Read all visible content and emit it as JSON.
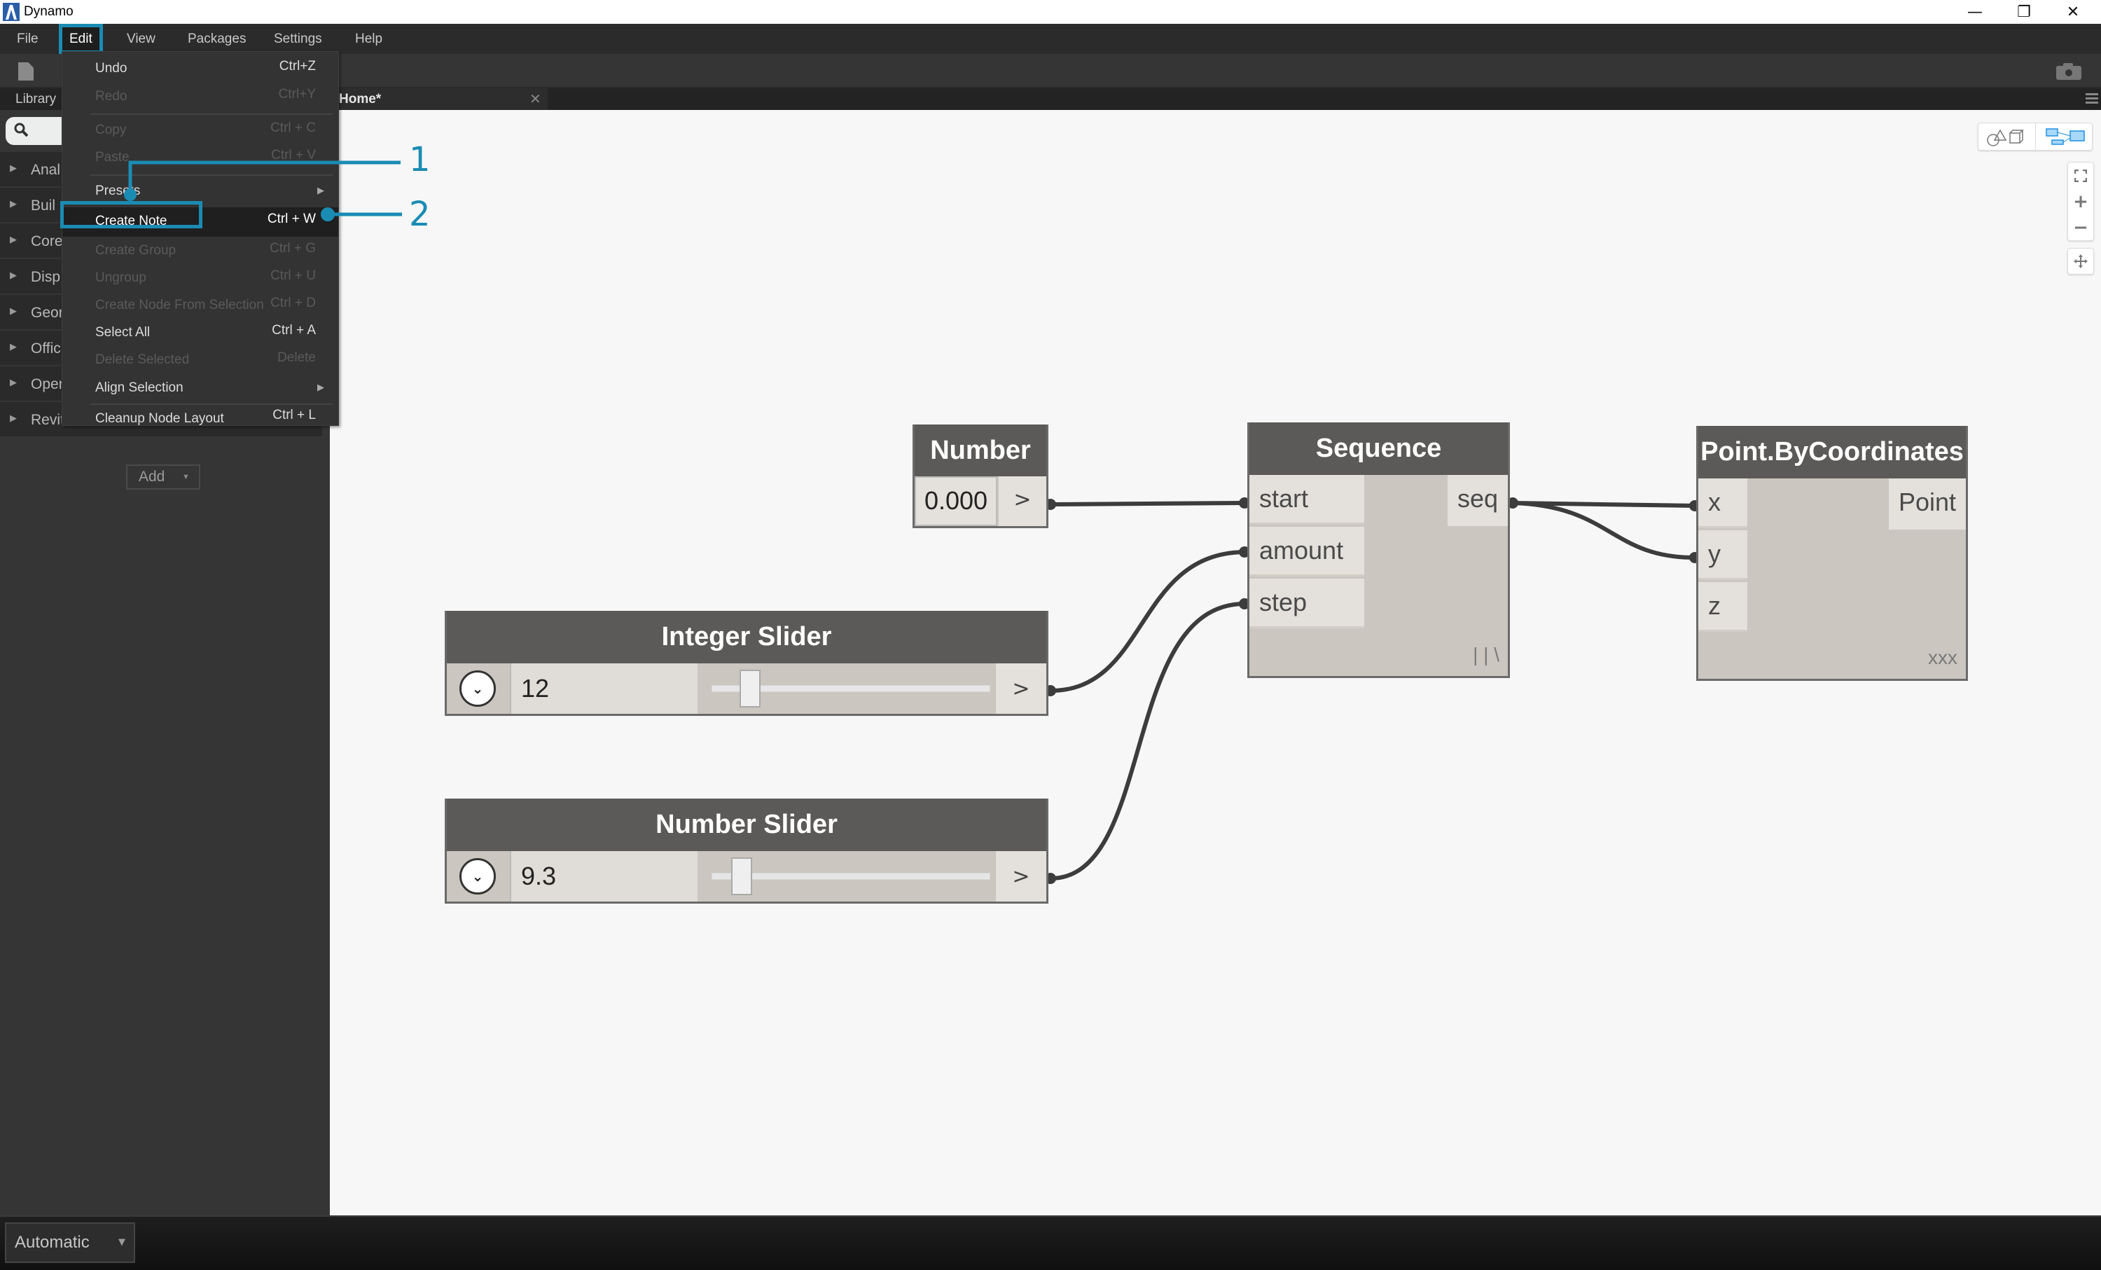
{
  "window": {
    "title": "Dynamo",
    "controls": {
      "minimize": "—",
      "restore": "❐",
      "close": "✕"
    }
  },
  "menubar": {
    "items": [
      "File",
      "Edit",
      "View",
      "Packages",
      "Settings",
      "Help"
    ],
    "active": "Edit"
  },
  "tabs": {
    "library_label": "Library",
    "workspace_tab": "Home*",
    "close_icon": "✕"
  },
  "library": {
    "search_placeholder": "",
    "items": [
      "Anal",
      "Buil",
      "Core",
      "Disp",
      "Geor",
      "Offic",
      "Oper",
      "Revit"
    ],
    "add_label": "Add",
    "add_caret": "▼"
  },
  "edit_menu": {
    "items": [
      {
        "label": "Undo",
        "shortcut": "Ctrl+Z",
        "enabled": true
      },
      {
        "label": "Redo",
        "shortcut": "Ctrl+Y",
        "enabled": false
      },
      {
        "separator": true
      },
      {
        "label": "Copy",
        "shortcut": "Ctrl + C",
        "enabled": false
      },
      {
        "label": "Paste",
        "shortcut": "Ctrl + V",
        "enabled": false
      },
      {
        "separator": true
      },
      {
        "label": "Presets",
        "submenu": true,
        "enabled": true
      },
      {
        "label": "Create Note",
        "shortcut": "Ctrl + W",
        "enabled": true,
        "highlighted": true
      },
      {
        "label": "Create Group",
        "shortcut": "Ctrl + G",
        "enabled": false
      },
      {
        "label": "Ungroup",
        "shortcut": "Ctrl + U",
        "enabled": false
      },
      {
        "label": "Create Node From Selection",
        "shortcut": "Ctrl + D",
        "enabled": false
      },
      {
        "label": "Select All",
        "shortcut": "Ctrl + A",
        "enabled": true
      },
      {
        "label": "Delete Selected",
        "shortcut": "Delete",
        "enabled": false
      },
      {
        "label": "Align Selection",
        "submenu": true,
        "enabled": true
      },
      {
        "separator": true
      },
      {
        "label": "Cleanup Node Layout",
        "shortcut": "Ctrl + L",
        "enabled": true
      }
    ],
    "submenu_arrow": "▶"
  },
  "callouts": [
    {
      "number": "1",
      "target": "Presets"
    },
    {
      "number": "2",
      "target": "Create Note"
    }
  ],
  "nodes": {
    "number": {
      "title": "Number",
      "value": "0.000",
      "out": ">"
    },
    "sequence": {
      "title": "Sequence",
      "inputs": [
        "start",
        "amount",
        "step"
      ],
      "output": "seq",
      "lacing": "| | \\"
    },
    "point": {
      "title": "Point.ByCoordinates",
      "inputs": [
        "x",
        "y",
        "z"
      ],
      "output": "Point",
      "lacing": "xxx"
    },
    "integer_slider": {
      "title": "Integer Slider",
      "value": "12",
      "position": 0.1,
      "out": ">",
      "expander": "⌄"
    },
    "number_slider": {
      "title": "Number Slider",
      "value": "9.3",
      "position": 0.07,
      "out": ">",
      "expander": "⌄"
    }
  },
  "canvas_controls": {
    "zoom_in": "+",
    "zoom_out": "−"
  },
  "bottombar": {
    "run_mode": "Automatic",
    "caret": "▼"
  },
  "colors": {
    "accent": "#1a8cb4",
    "node_header": "#5c5a58",
    "node_body": "#cbc6bf",
    "wire": "#3c3c3c"
  }
}
